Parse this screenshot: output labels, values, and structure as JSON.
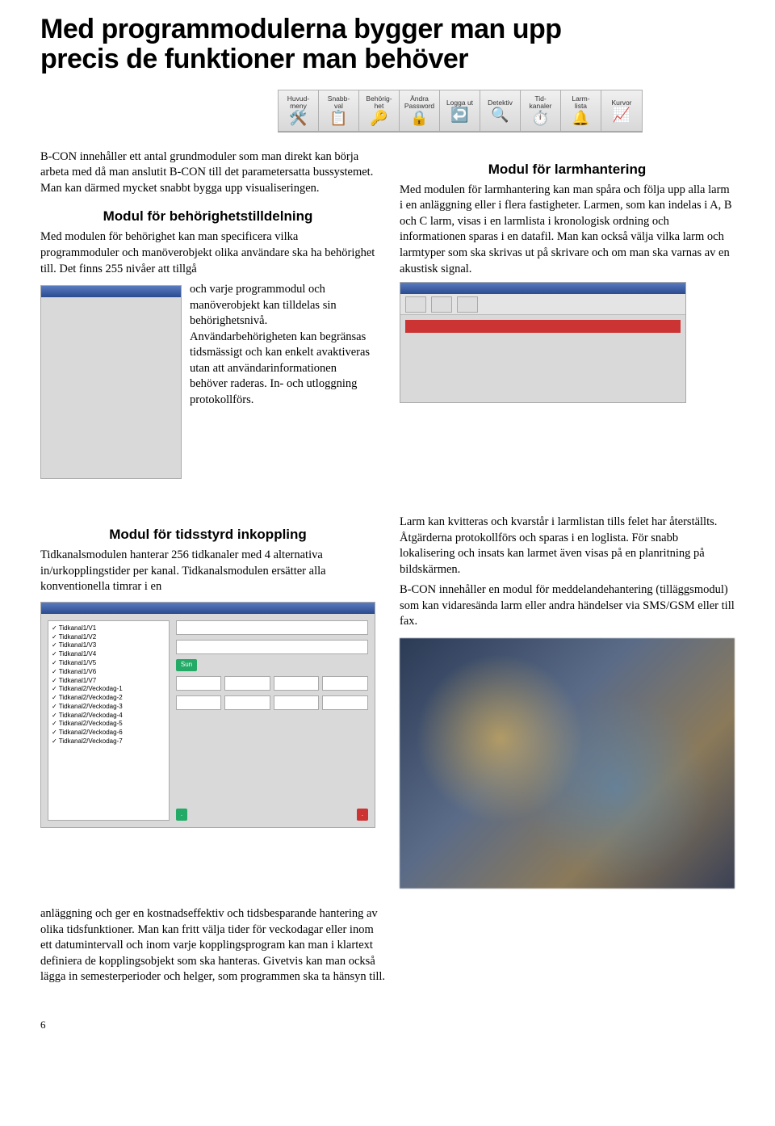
{
  "page_title": "Med programmodulerna bygger man upp\nprecis de funktioner man behöver",
  "toolbar": [
    {
      "label": "Huvud-\nmeny",
      "icon": "🛠️"
    },
    {
      "label": "Snabb-\nval",
      "icon": "📋"
    },
    {
      "label": "Behörig-\nhet",
      "icon": "🔑"
    },
    {
      "label": "Ändra\nPassword",
      "icon": "🔒"
    },
    {
      "label": "Logga ut",
      "icon": "↩️"
    },
    {
      "label": "Detektiv",
      "icon": "🔍"
    },
    {
      "label": "Tid-\nkanaler",
      "icon": "⏱️"
    },
    {
      "label": "Larm-\nlista",
      "icon": "🔔"
    },
    {
      "label": "Kurvor",
      "icon": "📈"
    }
  ],
  "intro_para": "B-CON innehåller ett antal grundmoduler som man direkt kan börja arbeta med då man anslutit B-CON till det parametersatta bussystemet. Man kan därmed mycket snabbt bygga upp visualiseringen.",
  "behorighet": {
    "heading": "Modul för behörighetstilldelning",
    "para1": "Med modulen för behörighet kan man specificera vilka programmoduler och manöverobjekt olika användare ska ha behörighet till. Det finns 255 nivåer att tillgå",
    "para2": "och varje programmodul och manöverobjekt kan tilldelas sin behörighetsnivå. Användarbehörigheten kan begränsas tidsmässigt och kan enkelt avaktiveras utan att användarinformationen behöver raderas. In- och utloggning protokollförs."
  },
  "larm": {
    "heading": "Modul för larmhantering",
    "para": "Med modulen för larmhantering kan man spåra och följa upp alla larm i en anläggning eller i flera fastigheter. Larmen, som kan indelas i A, B och C larm, visas i en larmlista i kronologisk ordning och informationen sparas i en datafil. Man kan också välja vilka larm och larmtyper som ska skrivas ut på skrivare och om man ska varnas av en akustisk signal."
  },
  "tidsstyrd": {
    "heading": "Modul för tidsstyrd inkoppling",
    "para": "Tidkanalsmodulen hanterar 256 tidkanaler med 4 alternativa in/urkopplingstider per kanal. Tidkanalsmodulen ersätter alla konventionella timrar i en"
  },
  "right_mid": {
    "p1": "Larm kan kvitteras och kvarstår i larmlistan tills felet har återställts. Åtgärderna protokollförs och sparas i en loglista. För snabb lokalisering och insats kan larmet även visas på en planritning på bildskärmen.",
    "p2": "B-CON innehåller en modul för meddelandehantering (tilläggsmodul) som kan vidaresända larm eller andra händelser via SMS/GSM eller till fax."
  },
  "timer_list": [
    "Tidkanal1/V1",
    "Tidkanal1/V2",
    "Tidkanal1/V3",
    "Tidkanal1/V4",
    "Tidkanal1/V5",
    "Tidkanal1/V6",
    "Tidkanal1/V7",
    "Tidkanal2/Veckodag-1",
    "Tidkanal2/Veckodag-2",
    "Tidkanal2/Veckodag-3",
    "Tidkanal2/Veckodag-4",
    "Tidkanal2/Veckodag-5",
    "Tidkanal2/Veckodag-6",
    "Tidkanal2/Veckodag-7"
  ],
  "bottom_para": "anläggning och ger en kostnadseffektiv och tidsbesparande hantering av olika tidsfunktioner. Man kan fritt välja tider för veckodagar eller inom ett datumintervall och inom varje kopplingsprogram kan man i klartext definiera de kopplingsobjekt som ska hanteras. Givetvis kan man också lägga in semesterperioder och helger, som programmen ska ta hänsyn till.",
  "page_number": "6"
}
